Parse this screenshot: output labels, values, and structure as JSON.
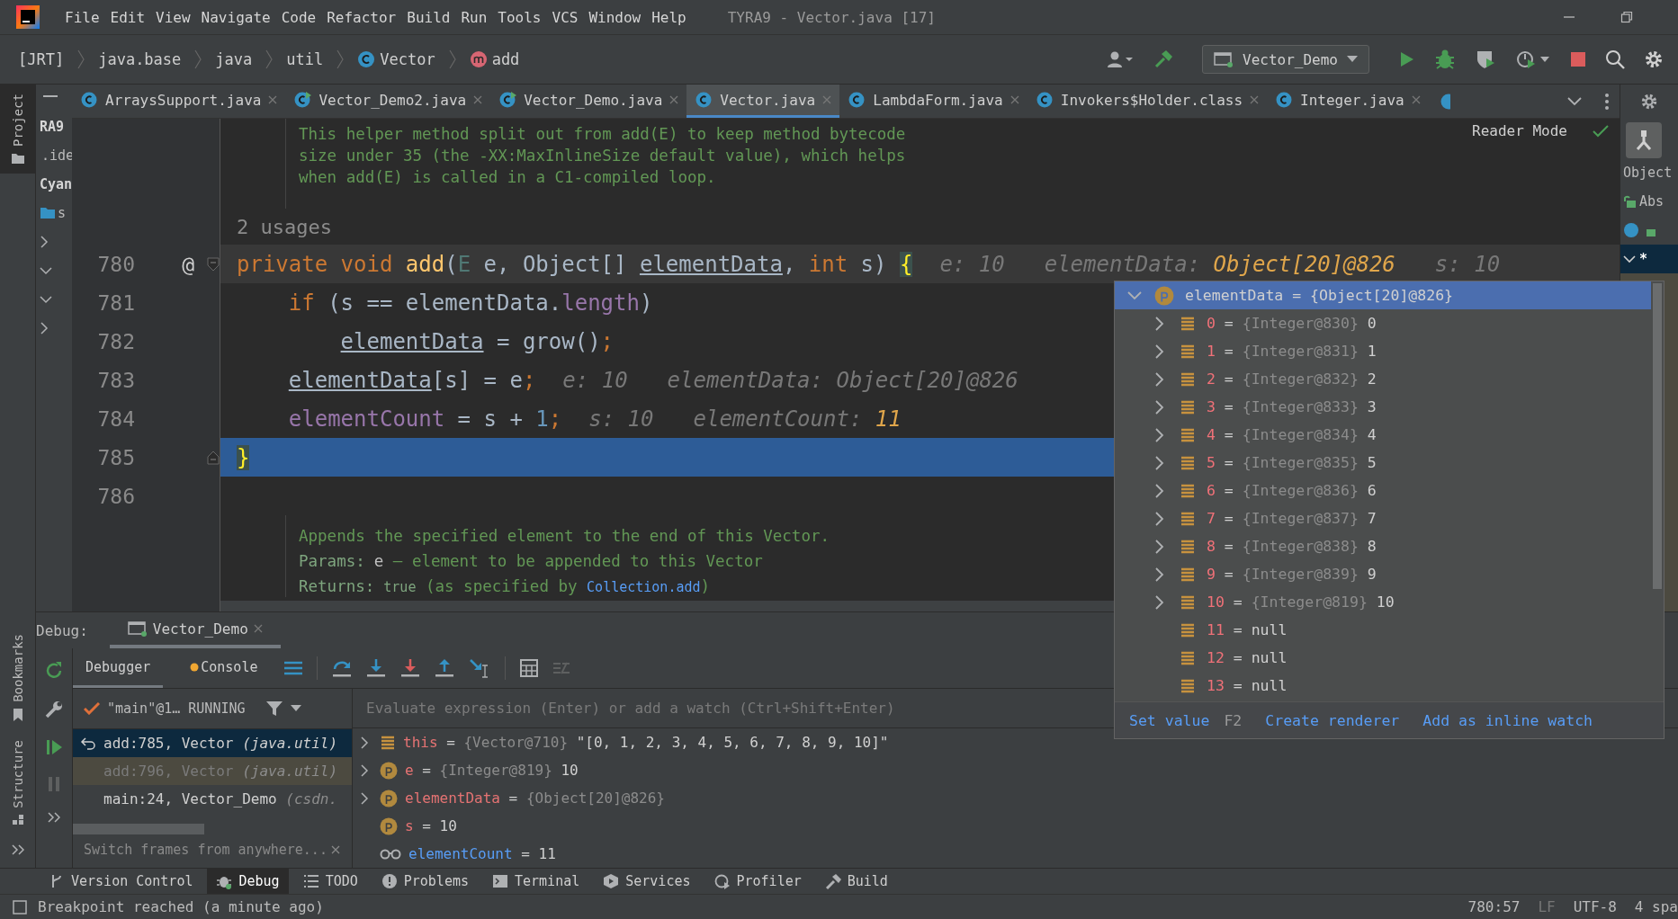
{
  "menu": [
    "File",
    "Edit",
    "View",
    "Navigate",
    "Code",
    "Refactor",
    "Build",
    "Run",
    "Tools",
    "VCS",
    "Window",
    "Help"
  ],
  "window_title": "TYRA9 - Vector.java [17]",
  "breadcrumb": [
    {
      "text": "[JRT]",
      "kind": "plain"
    },
    {
      "text": "java.base",
      "kind": "plain"
    },
    {
      "text": "java",
      "kind": "plain"
    },
    {
      "text": "util",
      "kind": "plain"
    },
    {
      "text": "Vector",
      "kind": "class"
    },
    {
      "text": "add",
      "kind": "method"
    }
  ],
  "run_config": "Vector_Demo",
  "tabs": [
    {
      "label": "ArraysSupport.java",
      "kind": "class",
      "selected": false
    },
    {
      "label": "Vector_Demo2.java",
      "kind": "main",
      "selected": false
    },
    {
      "label": "Vector_Demo.java",
      "kind": "main",
      "selected": false
    },
    {
      "label": "Vector.java",
      "kind": "class",
      "selected": true
    },
    {
      "label": "LambdaForm.java",
      "kind": "class",
      "selected": false
    },
    {
      "label": "Invokers$Holder.class",
      "kind": "class",
      "selected": false
    },
    {
      "label": "Integer.java",
      "kind": "class",
      "selected": false
    }
  ],
  "project_tool": "Project",
  "project_items": [
    {
      "text": "RA9",
      "kind": "bold"
    },
    {
      "text": ".ide",
      "kind": "folder"
    },
    {
      "text": "Cyan",
      "kind": "bold"
    },
    {
      "text": "s",
      "kind": "folder"
    }
  ],
  "structure_items": [
    "Object",
    "Abs",
    "*"
  ],
  "editor": {
    "doc_top": [
      "This helper method split out from add(E) to keep method bytecode",
      "size under 35 (the -XX:MaxInlineSize default value), which helps",
      "when add(E) is called in a C1-compiled loop."
    ],
    "usages": "2 usages",
    "reader_mode": "Reader Mode",
    "lines": [
      {
        "number": "780",
        "mark": "@",
        "kind": "fold_start",
        "current": true,
        "execution": false,
        "tokens": [
          {
            "text": "private void ",
            "kind": "keyword"
          },
          {
            "text": "add",
            "kind": "method"
          },
          {
            "text": "(",
            "kind": "plain"
          },
          {
            "text": "E",
            "kind": "typeparam"
          },
          {
            "text": " e, Object[] ",
            "kind": "plain"
          },
          {
            "text": "elementData",
            "kind": "reassigned"
          },
          {
            "text": ", ",
            "kind": "plain"
          },
          {
            "text": "int",
            "kind": "keyword"
          },
          {
            "text": " s) ",
            "kind": "plain"
          },
          {
            "text": "{",
            "kind": "brace"
          }
        ],
        "hints": [
          {
            "label": "e:",
            "value": "10",
            "highlight": false
          },
          {
            "label": "elementData:",
            "value": "Object[20]@826",
            "highlight": true
          },
          {
            "label": "s:",
            "value": "10",
            "highlight": false
          }
        ],
        "children": [
          {
            "number": "781",
            "current": false,
            "execution": false,
            "tokens": [
              {
                "text": "if",
                "kind": "keyword"
              },
              {
                "text": " (s == elementData.",
                "kind": "plain"
              },
              {
                "text": "length",
                "kind": "field"
              },
              {
                "text": ")",
                "kind": "plain"
              }
            ],
            "children": [
              {
                "number": "782",
                "current": false,
                "execution": false,
                "tokens": [
                  {
                    "text": "elementData",
                    "kind": "reassigned"
                  },
                  {
                    "text": " = grow()",
                    "kind": "plain"
                  },
                  {
                    "text": ";",
                    "kind": "keyword"
                  }
                ]
              }
            ]
          },
          {
            "number": "783",
            "current": false,
            "execution": false,
            "tokens": [
              {
                "text": "elementData",
                "kind": "reassigned"
              },
              {
                "text": "[s] = e",
                "kind": "plain"
              },
              {
                "text": ";",
                "kind": "keyword"
              }
            ],
            "hints": [
              {
                "label": "e:",
                "value": "10",
                "highlight": false
              },
              {
                "label": "elementData:",
                "value": "Object[20]@826",
                "highlight": false
              }
            ]
          },
          {
            "number": "784",
            "current": false,
            "execution": false,
            "tokens": [
              {
                "text": "elementCount",
                "kind": "field"
              },
              {
                "text": " = s + ",
                "kind": "plain"
              },
              {
                "text": "1",
                "kind": "number"
              },
              {
                "text": ";",
                "kind": "keyword"
              }
            ],
            "hints": [
              {
                "label": "s:",
                "value": "10",
                "highlight": false
              },
              {
                "label": "elementCount:",
                "value": "11",
                "highlight": true
              }
            ]
          }
        ]
      },
      {
        "number": "785",
        "kind": "fold_end",
        "current": false,
        "execution": true,
        "tokens": [
          {
            "text": "}",
            "kind": "brace"
          }
        ]
      },
      {
        "number": "786",
        "current": false,
        "execution": false
      }
    ],
    "doc_bottom": {
      "summary": "Appends the specified element to the end of this Vector.",
      "params_label": "Params:",
      "params_name": "e",
      "params_text": " – element to be appended to this Vector",
      "returns_label": "Returns:",
      "returns_code": "true",
      "returns_text": " (as specified by ",
      "returns_link": "Collection.add",
      "returns_end": ")"
    }
  },
  "popup": {
    "root": {
      "name": "elementData",
      "op": "=",
      "type": "{Object[20]@826}",
      "expanded": true,
      "selected": true
    },
    "rows": [
      {
        "index": "0",
        "op": "=",
        "type": "{Integer@830}",
        "value": "0",
        "expandable": true
      },
      {
        "index": "1",
        "op": "=",
        "type": "{Integer@831}",
        "value": "1",
        "expandable": true
      },
      {
        "index": "2",
        "op": "=",
        "type": "{Integer@832}",
        "value": "2",
        "expandable": true
      },
      {
        "index": "3",
        "op": "=",
        "type": "{Integer@833}",
        "value": "3",
        "expandable": true
      },
      {
        "index": "4",
        "op": "=",
        "type": "{Integer@834}",
        "value": "4",
        "expandable": true
      },
      {
        "index": "5",
        "op": "=",
        "type": "{Integer@835}",
        "value": "5",
        "expandable": true
      },
      {
        "index": "6",
        "op": "=",
        "type": "{Integer@836}",
        "value": "6",
        "expandable": true
      },
      {
        "index": "7",
        "op": "=",
        "type": "{Integer@837}",
        "value": "7",
        "expandable": true
      },
      {
        "index": "8",
        "op": "=",
        "type": "{Integer@838}",
        "value": "8",
        "expandable": true
      },
      {
        "index": "9",
        "op": "=",
        "type": "{Integer@839}",
        "value": "9",
        "expandable": true
      },
      {
        "index": "10",
        "op": "=",
        "type": "{Integer@819}",
        "value": "10",
        "expandable": true
      },
      {
        "index": "11",
        "op": "=",
        "value": "null",
        "expandable": false
      },
      {
        "index": "12",
        "op": "=",
        "value": "null",
        "expandable": false
      },
      {
        "index": "13",
        "op": "=",
        "value": "null",
        "expandable": false
      }
    ],
    "actions": [
      {
        "label": "Set value",
        "shortcut": "F2"
      },
      {
        "label": "Create renderer"
      },
      {
        "label": "Add as inline watch"
      }
    ]
  },
  "debug": {
    "title": "Debug:",
    "session": "Vector_Demo",
    "subtabs": [
      {
        "label": "Debugger",
        "selected": true
      },
      {
        "label": "Console",
        "selected": false
      }
    ],
    "thread": "\"main\"@1… RUNNING",
    "frames": [
      {
        "method": "add:785, Vector",
        "package": "(java.util)",
        "selected": true,
        "dimmed": false
      },
      {
        "method": "add:796, Vector",
        "package": "(java.util)",
        "selected": false,
        "dimmed": true
      },
      {
        "method": "main:24, Vector_Demo",
        "package": "(csdn.",
        "selected": false,
        "dimmed": false
      }
    ],
    "switch_hint": "Switch frames from anywhere...",
    "evaluate_placeholder": "Evaluate expression (Enter) or add a watch (Ctrl+Shift+Enter)",
    "variables": [
      {
        "name": "this",
        "op": "=",
        "kind": "field",
        "type": "{Vector@710}",
        "value": "\"[0, 1, 2, 3, 4, 5, 6, 7, 8, 9, 10]\"",
        "expandable": true
      },
      {
        "name": "e",
        "op": "=",
        "kind": "param",
        "type": "{Integer@819}",
        "value": "10",
        "expandable": true
      },
      {
        "name": "elementData",
        "op": "=",
        "kind": "param",
        "type": "{Object[20]@826}",
        "expandable": true
      },
      {
        "name": "s",
        "op": "=",
        "kind": "param",
        "value": "10",
        "expandable": false
      },
      {
        "name": "elementCount",
        "op": "=",
        "kind": "watch",
        "value": "11",
        "expandable": false
      }
    ]
  },
  "side_tools": [
    "Bookmarks",
    "Structure"
  ],
  "tool_windows": [
    {
      "label": "Version Control",
      "kind": "vcs",
      "selected": false
    },
    {
      "label": "Debug",
      "kind": "bug",
      "selected": true
    },
    {
      "label": "TODO",
      "kind": "list",
      "selected": false
    },
    {
      "label": "Problems",
      "kind": "problems",
      "selected": false
    },
    {
      "label": "Terminal",
      "kind": "terminal",
      "selected": false
    },
    {
      "label": "Services",
      "kind": "services",
      "selected": false
    },
    {
      "label": "Profiler",
      "kind": "profiler",
      "selected": false
    },
    {
      "label": "Build",
      "kind": "build",
      "selected": false
    }
  ],
  "status_bar": {
    "message": "Breakpoint reached (a minute ago)",
    "position": "780:57",
    "line_sep": "LF",
    "encoding": "UTF-8",
    "indent": "4 spa"
  }
}
